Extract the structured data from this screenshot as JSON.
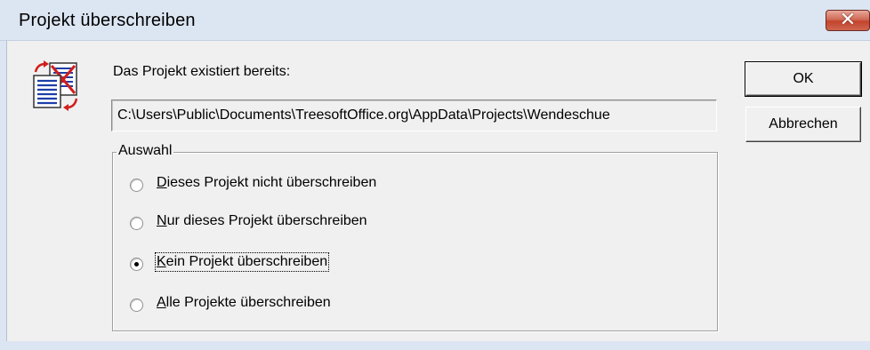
{
  "window": {
    "title": "Projekt überschreiben",
    "close_glyph": "✕"
  },
  "message": {
    "label": "Das Projekt existiert bereits:",
    "path": "C:\\Users\\Public\\Documents\\TreesoftOffice.org\\AppData\\Projects\\Wendeschue"
  },
  "buttons": {
    "ok_label": "OK",
    "cancel_label": "Abbrechen"
  },
  "group": {
    "legend": "Auswahl",
    "options": [
      {
        "accel": "D",
        "rest": "ieses Projekt nicht überschreiben",
        "selected": false
      },
      {
        "accel": "N",
        "rest": "ur dieses Projekt überschreiben",
        "selected": false
      },
      {
        "accel": "K",
        "rest": "ein Projekt überschreiben",
        "selected": true
      },
      {
        "accel": "A",
        "rest": "lle Projekte überschreiben",
        "selected": false
      }
    ]
  },
  "icons": {
    "dialog_icon": "overwrite-documents-icon"
  },
  "colors": {
    "titlebar": "#dce5f2",
    "close_button": "#c4442c",
    "dialog_bg": "#f0f0f0"
  }
}
